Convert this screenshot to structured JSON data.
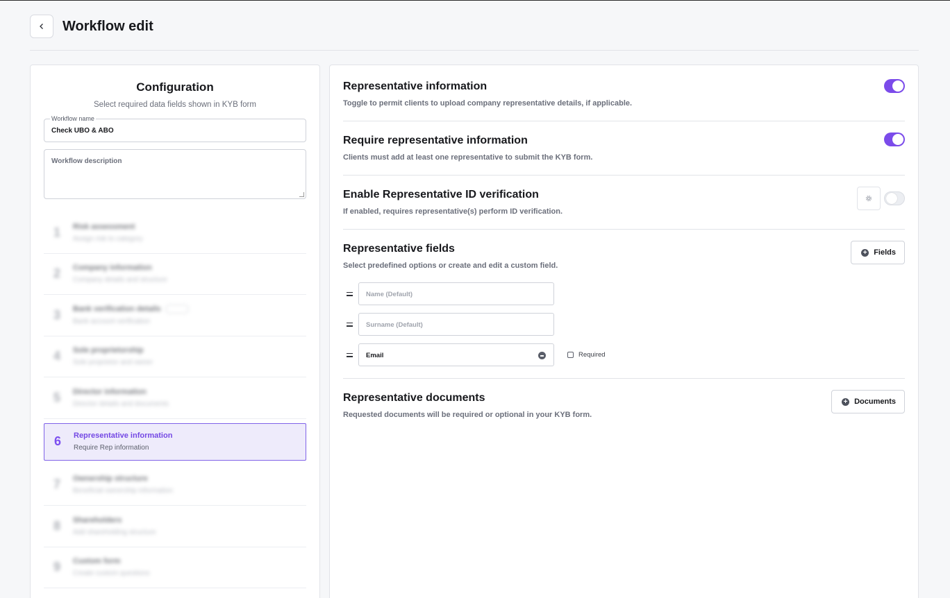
{
  "header": {
    "title": "Workflow edit"
  },
  "config": {
    "title": "Configuration",
    "subtitle": "Select required data fields shown in KYB form",
    "workflow_name_label": "Workflow name",
    "workflow_name_value": "Check UBO & ABO",
    "workflow_description_placeholder": "Workflow description",
    "steps": [
      {
        "num": "1",
        "name": "Risk assessment",
        "desc": "Assign risk to category"
      },
      {
        "num": "2",
        "name": "Company information",
        "desc": "Company details and structure"
      },
      {
        "num": "3",
        "name": "Bank verification details",
        "desc": "Bank account verification"
      },
      {
        "num": "4",
        "name": "Sole proprietorship",
        "desc": "Sole proprietor and owner"
      },
      {
        "num": "5",
        "name": "Director information",
        "desc": "Director details and documents"
      },
      {
        "num": "6",
        "name": "Representative information",
        "desc": "Require Rep information"
      },
      {
        "num": "7",
        "name": "Ownership structure",
        "desc": "Beneficial ownership information"
      },
      {
        "num": "8",
        "name": "Shareholders",
        "desc": "Add shareholding structure"
      },
      {
        "num": "9",
        "name": "Custom form",
        "desc": "Create custom questions"
      }
    ],
    "active_step": 5
  },
  "sections": {
    "rep_info": {
      "title": "Representative information",
      "desc": "Toggle to permit clients to upload company representative details, if applicable.",
      "enabled": true
    },
    "require_rep": {
      "title": "Require representative information",
      "desc": "Clients must add at least one representative to submit the KYB form.",
      "enabled": true
    },
    "id_verification": {
      "title": "Enable Representative ID verification",
      "desc": "If enabled, requires representative(s) perform ID verification.",
      "enabled": false
    },
    "rep_fields": {
      "title": "Representative fields",
      "desc": "Select predefined options or create and edit a custom field.",
      "button_label": "Fields",
      "fields": [
        {
          "placeholder": "Name (Default)"
        },
        {
          "placeholder": "Surname (Default)"
        },
        {
          "value": "Email",
          "required_label": "Required",
          "required": false
        }
      ]
    },
    "rep_docs": {
      "title": "Representative documents",
      "desc": "Requested documents will be required or optional in your KYB form.",
      "button_label": "Documents"
    }
  },
  "colors": {
    "accent": "#7b4bea",
    "active_bg": "#eeebfb",
    "text_muted": "#6b6f7b"
  },
  "icons": [
    "chevron-left-icon",
    "gear-icon",
    "plus-circle-icon",
    "drag-handle-icon",
    "minus-circle-icon"
  ]
}
